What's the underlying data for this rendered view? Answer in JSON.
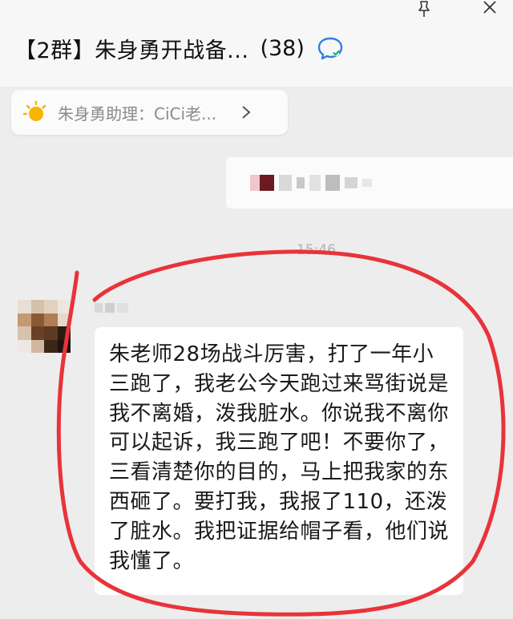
{
  "header": {
    "chat_title": "【2群】朱身勇开战备...",
    "member_count": "(38)"
  },
  "notice": {
    "text": "朱身勇助理：CiCi老..."
  },
  "messages": {
    "timestamp": "15:46",
    "incoming_text": "朱老师28场战斗厉害，打了一年小三跑了，我老公今天跑过来骂街说是我不离婚，泼我脏水。你说我不离你可以起诉，我三跑了吧！不要你了，三看清楚你的目的，马上把我家的东西砸了。要打我，我报了110，还泼了脏水。我把证据给帽子看，他们说我懂了。"
  },
  "colors": {
    "annotation_red": "#e8333b",
    "chat_background": "#ededed",
    "icon_blue": "#2f7fe0",
    "sun_yellow": "#f7b500"
  },
  "icons": {
    "pin": "pin-icon",
    "close": "close-icon",
    "chat_info": "chat-info-icon",
    "notice": "sun-icon",
    "chevron": "chevron-right-icon"
  }
}
